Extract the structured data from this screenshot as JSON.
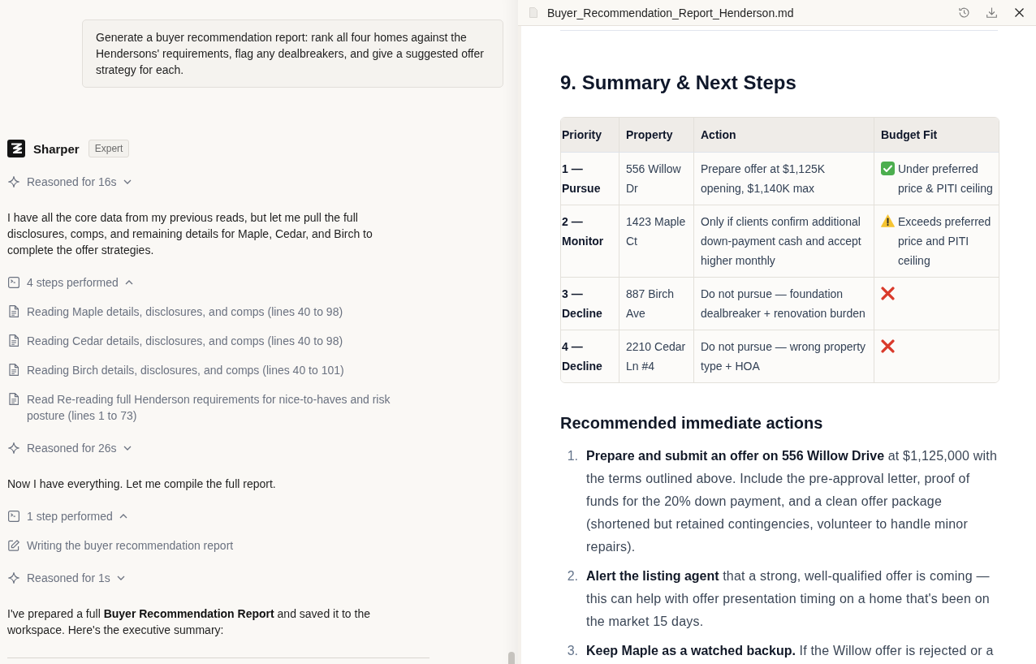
{
  "conversation": {
    "user_message": "Generate a buyer recommendation report: rank all four homes against the Hendersons' requirements, flag any dealbreakers, and give a suggested offer strategy for each.",
    "assistant": {
      "name": "Sharper",
      "badge": "Expert"
    },
    "blocks": [
      {
        "kind": "reasoning",
        "label": "Reasoned for 16s",
        "expanded": false
      },
      {
        "kind": "text",
        "text": "I have all the core data from my previous reads, but let me pull the full disclosures, comps, and remaining details for Maple, Cedar, and Birch to complete the offer strategies."
      },
      {
        "kind": "steps",
        "label": "4 steps performed",
        "expanded": true,
        "items": [
          {
            "kind": "read",
            "text": "Reading Maple details, disclosures, and comps (lines 40 to 98)"
          },
          {
            "kind": "read",
            "text": "Reading Cedar details, disclosures, and comps (lines 40 to 98)"
          },
          {
            "kind": "read",
            "text": "Reading Birch details, disclosures, and comps (lines 40 to 101)"
          },
          {
            "kind": "read",
            "text": "Read Re-reading full Henderson requirements for nice-to-haves and risk posture (lines 1 to 73)"
          }
        ]
      },
      {
        "kind": "reasoning",
        "label": "Reasoned for 26s",
        "expanded": false
      },
      {
        "kind": "text",
        "text": "Now I have everything. Let me compile the full report."
      },
      {
        "kind": "steps",
        "label": "1 step performed",
        "expanded": true,
        "items": [
          {
            "kind": "write",
            "text": "Writing the buyer recommendation report"
          }
        ]
      },
      {
        "kind": "reasoning",
        "label": "Reasoned for 1s",
        "expanded": false
      },
      {
        "kind": "text",
        "text": "I've prepared a full **Buyer Recommendation Report** and saved it to the workspace. Here's the executive summary:"
      }
    ]
  },
  "document": {
    "file_name": "Buyer_Recommendation_Report_Henderson.md",
    "heading": "9. Summary & Next Steps",
    "table": {
      "columns": [
        "Priority",
        "Property",
        "Action",
        "Budget Fit"
      ],
      "rows": [
        {
          "priority": "1 — Pursue",
          "property": "556 Willow Dr",
          "action": "Prepare offer at $1,125K opening, $1,140K max",
          "budget_fit": {
            "kind": "pass",
            "text": "Under preferred price & PITI ceiling"
          }
        },
        {
          "priority": "2 — Monitor",
          "property": "1423 Maple Ct",
          "action": "Only if clients confirm additional down-payment cash and accept higher monthly",
          "budget_fit": {
            "kind": "warning",
            "text": "Exceeds preferred price and PITI ceiling"
          }
        },
        {
          "priority": "3 — Decline",
          "property": "887 Birch Ave",
          "action": "Do not pursue — foundation dealbreaker + renovation burden",
          "budget_fit": {
            "kind": "fail"
          }
        },
        {
          "priority": "4 — Decline",
          "property": "2210 Cedar Ln #4",
          "action": "Do not pursue — wrong property type + HOA",
          "budget_fit": {
            "kind": "fail"
          }
        }
      ]
    },
    "subheading": "Recommended immediate actions",
    "actions": [
      {
        "number": "1.",
        "text": "**Prepare and submit an offer on 556 Willow Drive** at $1,125,000 with the terms outlined above. Include the pre-approval letter, proof of funds for the 20% down payment, and a clean offer package (shortened but retained contingencies, volunteer to handle minor repairs)."
      },
      {
        "number": "2.",
        "text": "**Alert the listing agent** that a strong, well-qualified offer is coming — this can help with offer presentation timing on a home that's been on the market 15 days."
      },
      {
        "number": "3.",
        "text": "**Keep Maple as a watched backup.** If the Willow offer is rejected or a"
      }
    ]
  }
}
